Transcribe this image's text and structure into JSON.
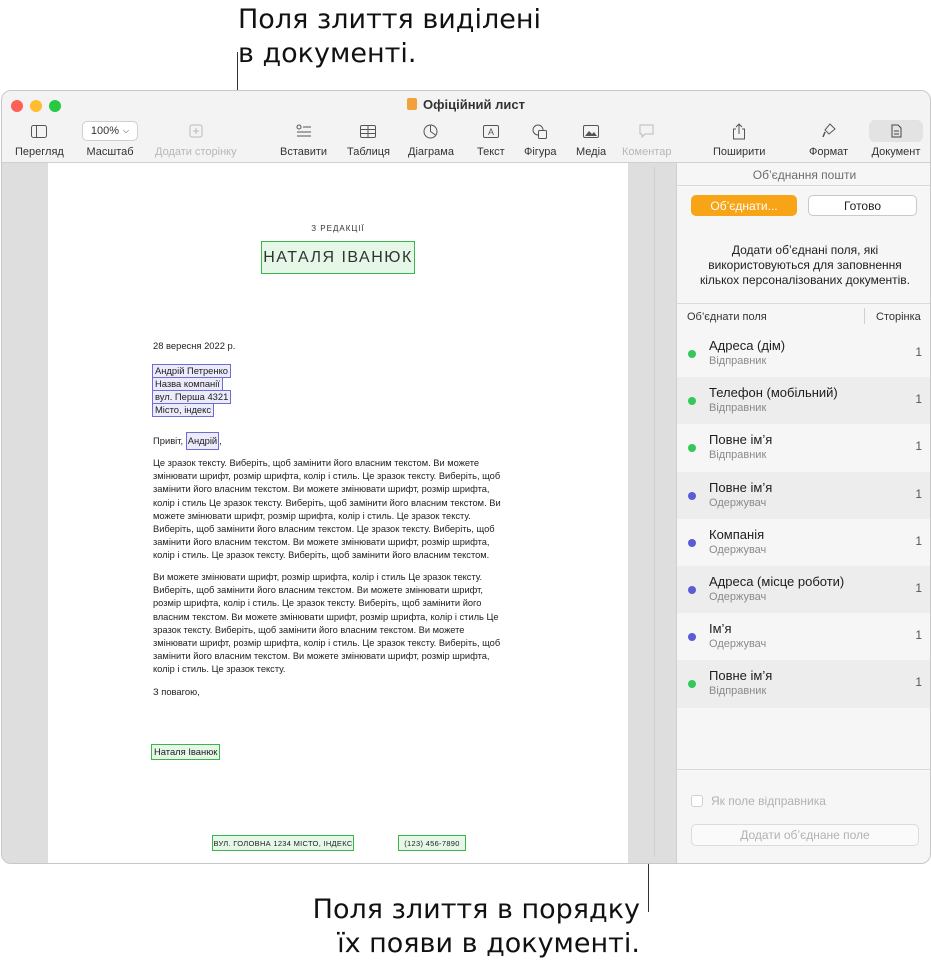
{
  "callouts": {
    "top_line1": "Поля злиття виділені",
    "top_line2": "в документі.",
    "bottom_line1": "Поля злиття в порядку",
    "bottom_line2": "їх появи в документі."
  },
  "window": {
    "title": "Офіційний лист"
  },
  "toolbar": {
    "view": "Перегляд",
    "zoom_value": "100%",
    "zoom": "Масштаб",
    "add_page": "Додати сторінку",
    "insert": "Вставити",
    "table": "Таблиця",
    "chart": "Діаграма",
    "text": "Текст",
    "shape": "Фігура",
    "media": "Медіа",
    "comment": "Коментар",
    "share": "Поширити",
    "format": "Формат",
    "document": "Документ"
  },
  "document": {
    "eyebrow": "З РЕДАКЦІЇ",
    "sender_name_heading": "НАТАЛЯ ІВАНЮК",
    "date": "28 вересня 2022 р.",
    "recipient_name": "Андрій Петренко",
    "company": "Назва компанії",
    "street": "вул. Перша 4321",
    "city": "Місто, індекс",
    "greeting_prefix": "Привіт, ",
    "greeting_name": "Андрій",
    "greeting_suffix": ",",
    "para1_lines": [
      "Це зразок тексту. Виберіть, щоб замінити його власним текстом. Ви можете",
      "змінювати шрифт, розмір шрифта, колір і стиль. Це зразок тексту. Виберіть, щоб",
      "замінити його власним текстом. Ви можете змінювати шрифт, розмір шрифта,",
      "колір і стиль Це зразок тексту. Виберіть, щоб замінити його власним текстом. Ви",
      "можете змінювати шрифт, розмір шрифта, колір і стиль. Це зразок тексту.",
      "Виберіть, щоб замінити його власним текстом. Це зразок тексту. Виберіть, щоб",
      "замінити його власним текстом. Ви можете змінювати шрифт, розмір шрифта,",
      "колір і стиль. Це зразок тексту. Виберіть, щоб замінити його власним текстом."
    ],
    "para2_lines": [
      "Ви можете змінювати шрифт, розмір шрифта, колір і стиль Це зразок тексту.",
      "Виберіть, щоб замінити його власним текстом. Ви можете змінювати шрифт,",
      "розмір шрифта, колір і стиль. Це зразок тексту. Виберіть, щоб замінити його",
      "власним текстом. Ви можете змінювати шрифт, розмір шрифта, колір і стиль Це",
      "зразок тексту. Виберіть, щоб замінити його власним текстом. Ви можете",
      "змінювати шрифт, розмір шрифта, колір і стиль. Це зразок тексту. Виберіть, щоб",
      "замінити його власним текстом. Ви можете змінювати шрифт, розмір шрифта,",
      "колір і стиль. Це зразок тексту."
    ],
    "closing": "З повагою,",
    "signature": "Наталя Іванюк",
    "footer_address": "ВУЛ. ГОЛОВНА 1234  МІСТО, ІНДЕКС",
    "footer_phone": "(123) 456-7890"
  },
  "sidebar": {
    "title": "Об’єднання пошти",
    "merge_button": "Об’єднати...",
    "done_button": "Готово",
    "description": "Додати об’єднані поля, які використовуються для заповнення кількох персоналізованих документів.",
    "col_fields": "Об’єднати поля",
    "col_page": "Сторінка",
    "fields": [
      {
        "name": "Адреса (дім)",
        "type": "Відправник",
        "page": "1",
        "color": "#34c759"
      },
      {
        "name": "Телефон (мобільний)",
        "type": "Відправник",
        "page": "1",
        "color": "#34c759"
      },
      {
        "name": "Повне ім’я",
        "type": "Відправник",
        "page": "1",
        "color": "#34c759"
      },
      {
        "name": "Повне ім’я",
        "type": "Одержувач",
        "page": "1",
        "color": "#5b5bd6"
      },
      {
        "name": "Компанія",
        "type": "Одержувач",
        "page": "1",
        "color": "#5b5bd6"
      },
      {
        "name": "Адреса (місце роботи)",
        "type": "Одержувач",
        "page": "1",
        "color": "#5b5bd6"
      },
      {
        "name": "Ім’я",
        "type": "Одержувач",
        "page": "1",
        "color": "#5b5bd6"
      },
      {
        "name": "Повне ім’я",
        "type": "Відправник",
        "page": "1",
        "color": "#34c759"
      }
    ],
    "sender_checkbox": "Як поле відправника",
    "add_field_button": "Додати об’єднане поле"
  }
}
